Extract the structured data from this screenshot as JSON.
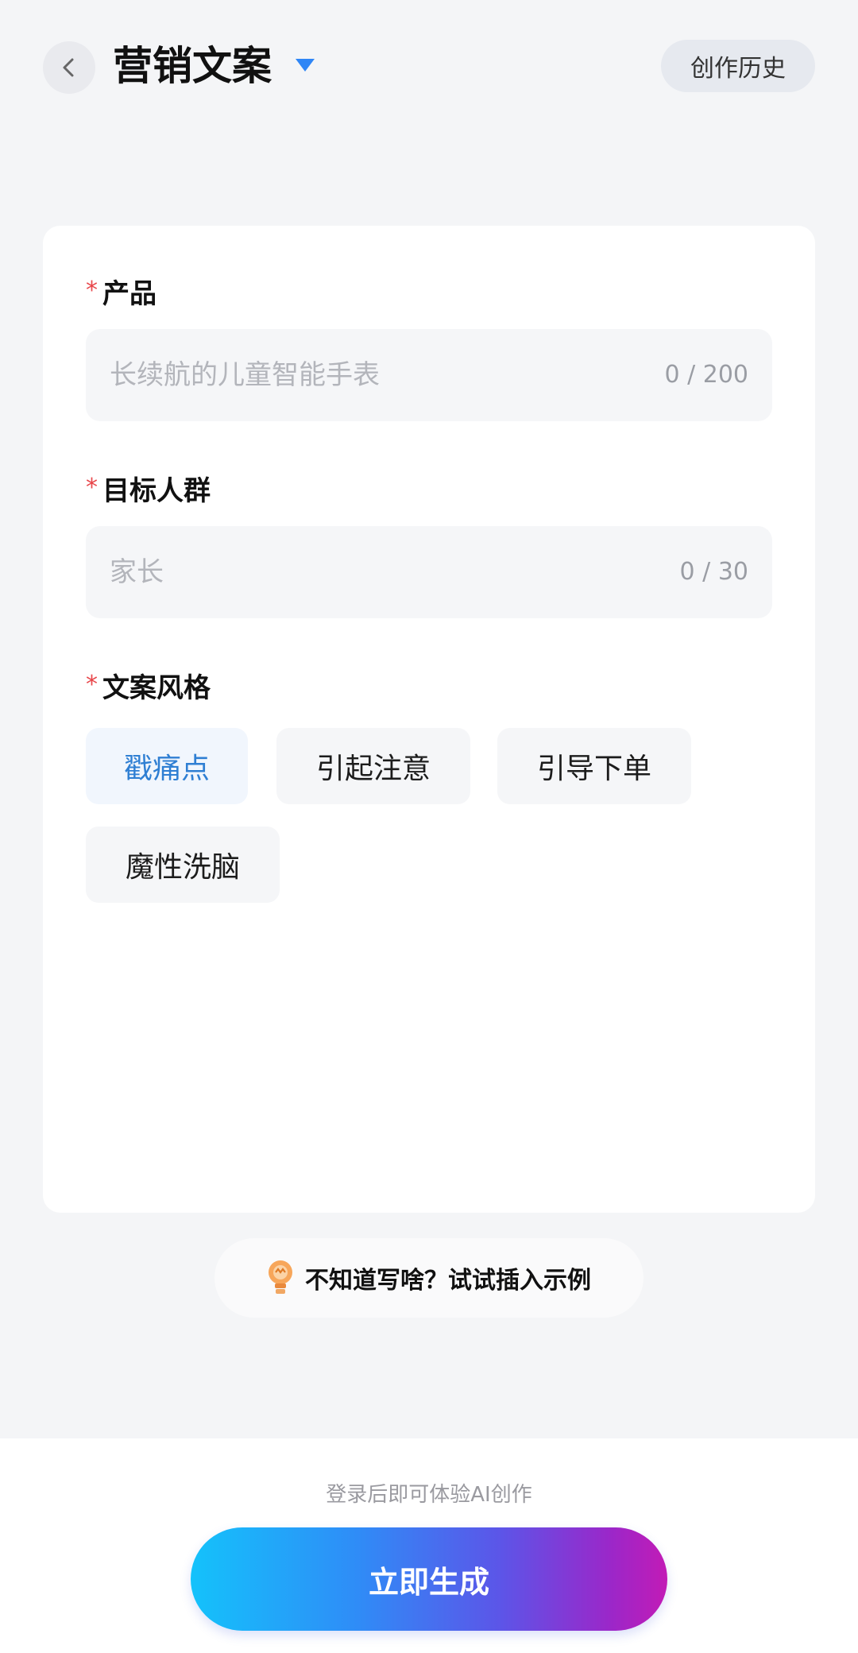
{
  "header": {
    "title": "营销文案",
    "history_label": "创作历史"
  },
  "form": {
    "product": {
      "label": "产品",
      "required_mark": "*",
      "placeholder": "长续航的儿童智能手表",
      "counter": "0 / 200"
    },
    "audience": {
      "label": "目标人群",
      "required_mark": "*",
      "placeholder": "家长",
      "counter": "0 / 30"
    },
    "style": {
      "label": "文案风格",
      "required_mark": "*",
      "options": [
        "戳痛点",
        "引起注意",
        "引导下单",
        "魔性洗脑"
      ],
      "selected": "戳痛点"
    }
  },
  "example": {
    "label": "不知道写啥？试试插入示例"
  },
  "footer": {
    "login_tip": "登录后即可体验AI创作",
    "generate_label": "立即生成"
  },
  "colors": {
    "accent": "#2f86f6",
    "required": "#e8464a",
    "selected_chip_text": "#2f7fd3"
  }
}
